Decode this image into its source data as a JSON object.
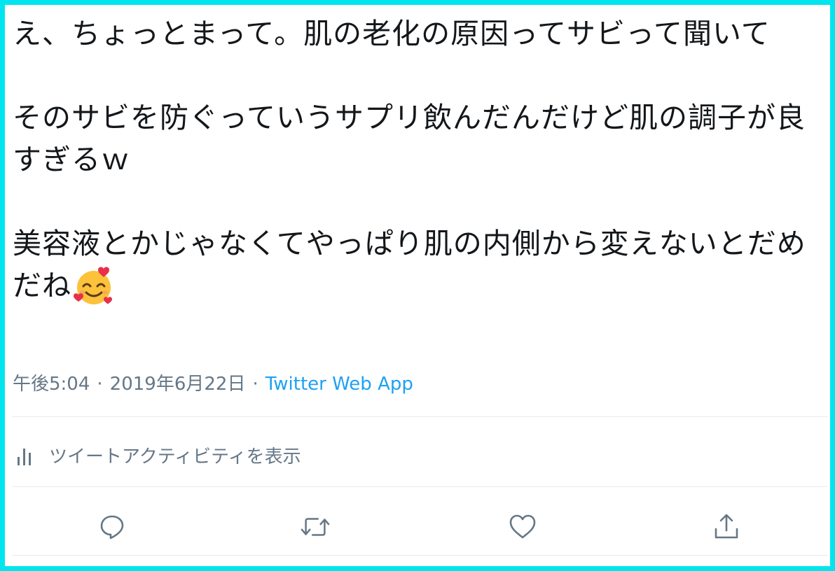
{
  "tweet": {
    "lines": {
      "p1": "え、ちょっとまって。肌の老化の原因ってサビって聞いて",
      "p2": "そのサビを防ぐっていうサプリ飲んだんだけど肌の調子が良すぎるｗ",
      "p3": "美容液とかじゃなくてやっぱり肌の内側から変えないとだめだね"
    },
    "emoji": "smiling-face-with-hearts"
  },
  "meta": {
    "time": "午後5:04",
    "separator": "·",
    "date": "2019年6月22日",
    "source": "Twitter Web App"
  },
  "activity": {
    "label": "ツイートアクティビティを表示",
    "icon": "bar-chart-icon"
  },
  "actions": {
    "reply_icon": "reply-icon",
    "retweet_icon": "retweet-icon",
    "like_icon": "heart-icon",
    "share_icon": "share-icon"
  },
  "colors": {
    "border": "#00e5ee",
    "text": "#14171a",
    "muted": "#657786",
    "link": "#1da1f2",
    "divider": "#e6ecf0"
  }
}
